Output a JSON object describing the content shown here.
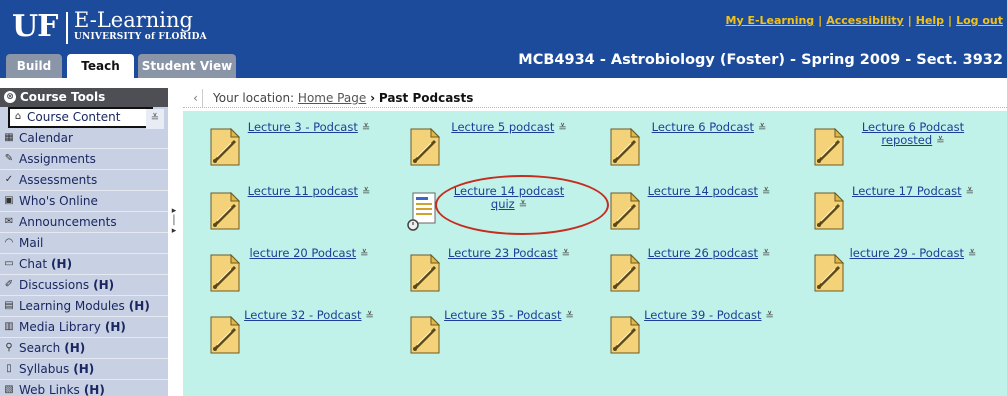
{
  "header": {
    "logo_uf": "UF",
    "logo_title": "E-Learning",
    "logo_sub": "UNIVERSITY of FLORIDA",
    "links": [
      "My E-Learning",
      "Accessibility",
      "Help",
      "Log out"
    ],
    "course_title": "MCB4934 - Astrobiology (Foster) - Spring 2009 - Sect. 3932"
  },
  "tabs": [
    "Build",
    "Teach",
    "Student View"
  ],
  "sidebar": {
    "title": "Course Tools",
    "items": [
      {
        "label": "Course Content",
        "suffix": ""
      },
      {
        "label": "Calendar",
        "suffix": ""
      },
      {
        "label": "Assignments",
        "suffix": ""
      },
      {
        "label": "Assessments",
        "suffix": ""
      },
      {
        "label": "Who's Online",
        "suffix": ""
      },
      {
        "label": "Announcements",
        "suffix": ""
      },
      {
        "label": "Mail",
        "suffix": ""
      },
      {
        "label": "Chat",
        "suffix": "(H)"
      },
      {
        "label": "Discussions",
        "suffix": "(H)"
      },
      {
        "label": "Learning Modules",
        "suffix": "(H)"
      },
      {
        "label": "Media Library",
        "suffix": "(H)"
      },
      {
        "label": "Search",
        "suffix": "(H)"
      },
      {
        "label": "Syllabus",
        "suffix": "(H)"
      },
      {
        "label": "Web Links",
        "suffix": "(H)"
      }
    ]
  },
  "breadcrumb": {
    "prefix": "Your location:",
    "home": "Home Page",
    "separator": "›",
    "current": "Past Podcasts"
  },
  "items": [
    [
      "Lecture 3 - Podcast",
      "Lecture 5 podcast",
      "Lecture 6 Podcast",
      "Lecture 6 Podcast reposted"
    ],
    [
      "Lecture 11 podcast",
      "Lecture 14 podcast quiz",
      "Lecture 14 podcast",
      "Lecture 17 Podcast"
    ],
    [
      "lecture 20 Podcast",
      "Lecture 23 Podcast",
      "Lecture 26 podcast",
      "lecture 29 - Podcast"
    ],
    [
      "Lecture 32 - Podcast",
      "Lecture 35 - Podcast",
      "Lecture 39 - Podcast"
    ]
  ],
  "colors": {
    "header_bg": "#1d4b9b",
    "link_gold": "#f3c21a",
    "content_bg": "#c1f2e9",
    "sidebar_bg": "#c8d0e4",
    "highlight": "#c62d1f"
  }
}
